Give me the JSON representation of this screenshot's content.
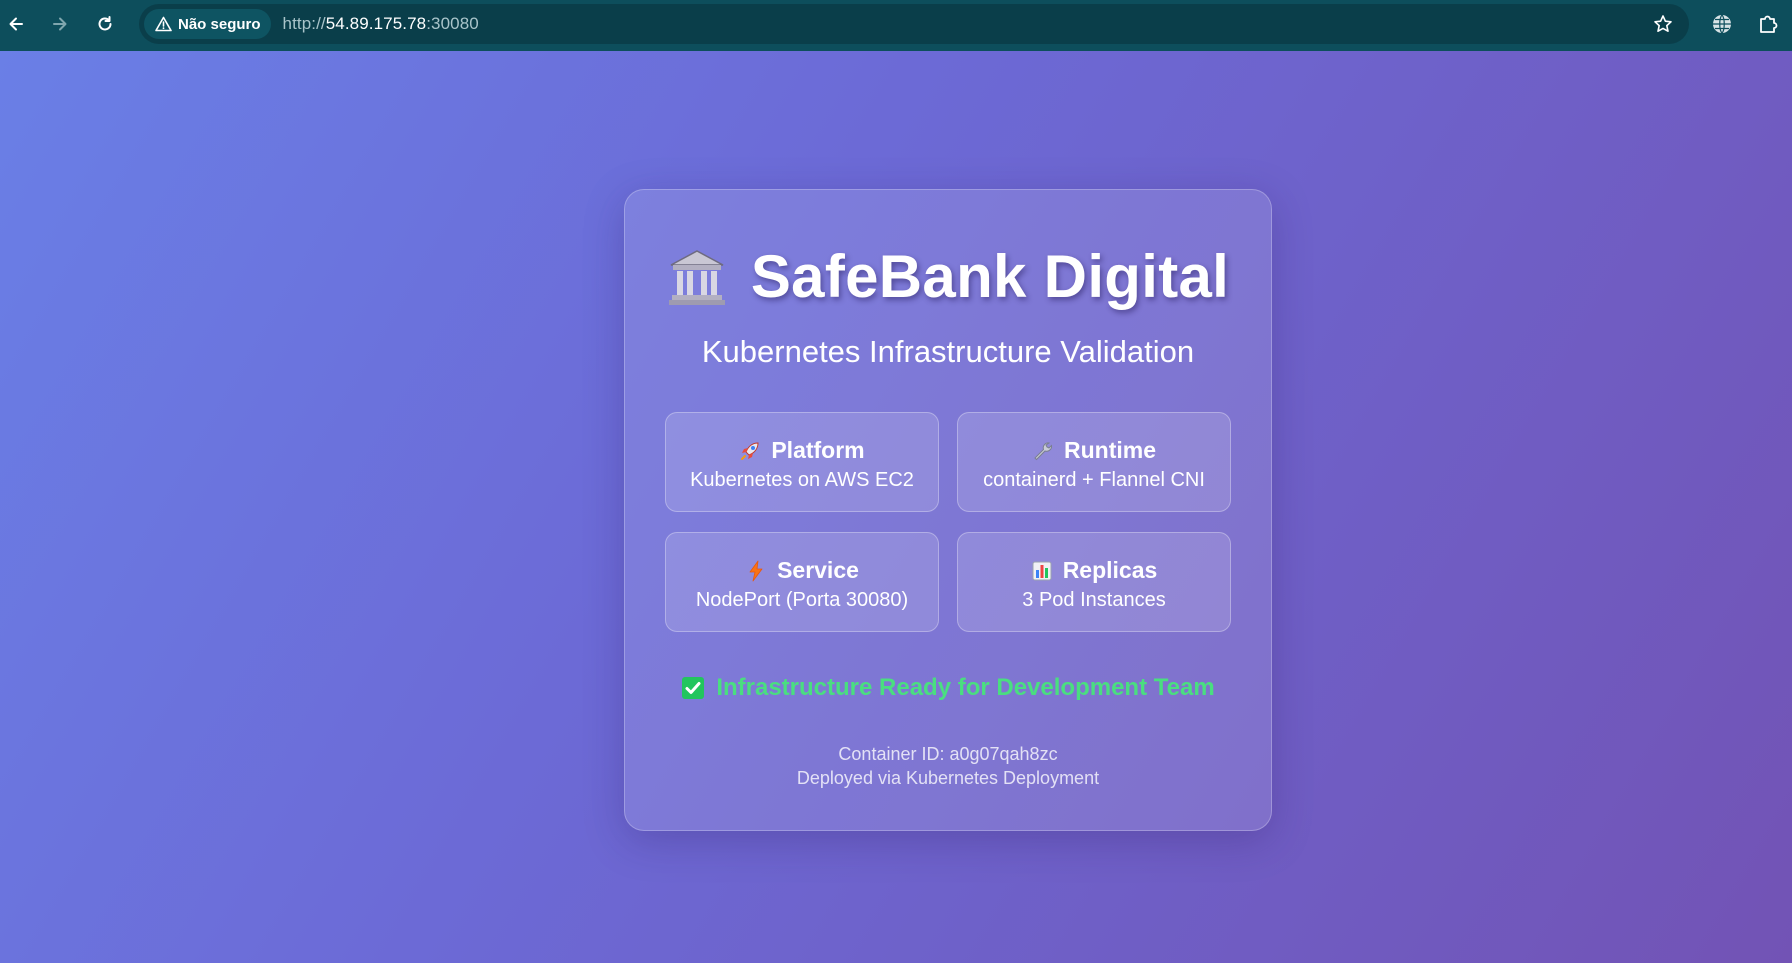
{
  "browser": {
    "security_label": "Não seguro",
    "url_prefix": "http://",
    "url_host": "54.89.175.78",
    "url_port": ":30080"
  },
  "page": {
    "title": "SafeBank Digital",
    "subtitle": "Kubernetes Infrastructure Validation",
    "cards": [
      {
        "icon": "rocket-icon",
        "label": "Platform",
        "value": "Kubernetes on AWS EC2"
      },
      {
        "icon": "wrench-icon",
        "label": "Runtime",
        "value": "containerd + Flannel CNI"
      },
      {
        "icon": "lightning-icon",
        "label": "Service",
        "value": "NodePort (Porta 30080)"
      },
      {
        "icon": "bar-chart-icon",
        "label": "Replicas",
        "value": "3 Pod Instances"
      }
    ],
    "status": "Infrastructure Ready for Development Team",
    "container_id": "Container ID: a0g07qah8zc",
    "deployed_via": "Deployed via Kubernetes Deployment"
  },
  "colors": {
    "chrome_bg": "#0d4e5c",
    "status_green": "#4ade80",
    "gradient_start": "#6a7fe6",
    "gradient_end": "#7253b5"
  }
}
